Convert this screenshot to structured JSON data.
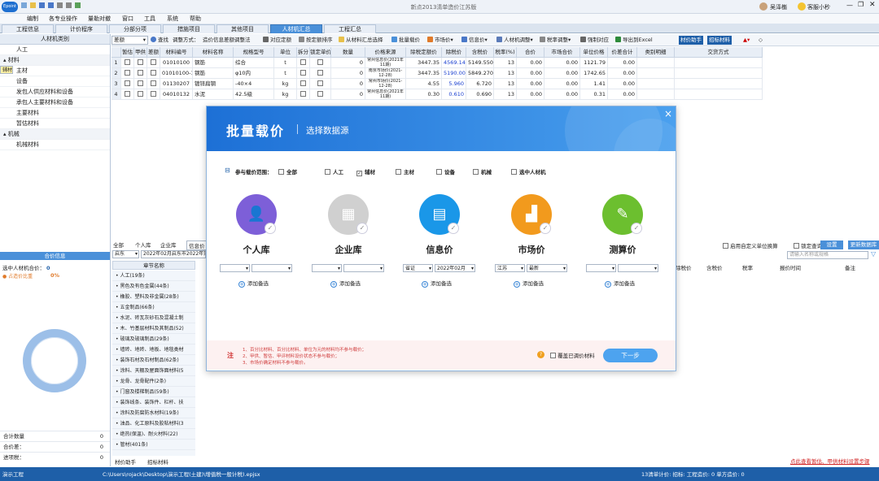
{
  "titlebar": {
    "title": "新点2013清单造价江苏版",
    "user": "吴泽櫆",
    "help": "客服小秒"
  },
  "menu": [
    "编制",
    "各专业操作",
    "量勒对撤",
    "窗口",
    "工具",
    "系统",
    "帮助"
  ],
  "tabs": [
    "工程信息",
    "计价程序",
    "分部分项",
    "措施项目",
    "其他项目",
    "人材机汇总",
    "工程汇总"
  ],
  "toolbar": {
    "filter": "差额",
    "search": "查找",
    "adjust": "调整方式：",
    "adjust_val": "造价信息差额调整法",
    "fixed": "对应定额",
    "sort": "按定额排序",
    "fromsum": "从材料汇总选择",
    "batch": "批量载价",
    "market": "市场价",
    "info": "信息价",
    "rcj": "人材机调整",
    "tax": "税率调整",
    "copy": "强制对应",
    "excel": "导出到Excel",
    "assist": "材价助手",
    "bid": "招标材料"
  },
  "left": {
    "header": "人材机类别",
    "items": [
      {
        "label": "人工",
        "type": "item"
      },
      {
        "label": "材料",
        "type": "grp"
      },
      {
        "label": "辅材",
        "type": "sel"
      },
      {
        "label": "主材",
        "type": "item"
      },
      {
        "label": "设备",
        "type": "item"
      },
      {
        "label": "发包人供应材料和设备",
        "type": "item"
      },
      {
        "label": "承包人主要材料和设备",
        "type": "item"
      },
      {
        "label": "主要材料",
        "type": "item"
      },
      {
        "label": "暂估材料",
        "type": "item"
      },
      {
        "label": "机械",
        "type": "grp"
      },
      {
        "label": "机械材料",
        "type": "item"
      }
    ]
  },
  "grid": {
    "headers": [
      "",
      "暂估",
      "甲供",
      "差额",
      "材料编号",
      "材料名称",
      "规格型号",
      "单位",
      "拆分",
      "锁定单价",
      "数量",
      "价格来源",
      "除税定额价",
      "除税价",
      "含税价",
      "税率(%)",
      "合价",
      "市场合价",
      "单位价格",
      "价差合计",
      "类别明细",
      "交货方式"
    ],
    "rows": [
      [
        "1",
        "",
        "",
        "",
        "01010100",
        "钢筋",
        "综合",
        "t",
        "",
        "",
        "0",
        "常州信息价(2021年11期)",
        "3447.35",
        "4569.140",
        "5149.550",
        "13",
        "0.00",
        "0.00",
        "1121.79",
        "0.00",
        "",
        ""
      ],
      [
        "2",
        "",
        "",
        "",
        "01010100-1",
        "钢筋",
        "φ10内",
        "t",
        "",
        "",
        "0",
        "南京市场价(2021-12-28)",
        "3447.35",
        "5190.000",
        "5849.270",
        "13",
        "0.00",
        "0.00",
        "1742.65",
        "0.00",
        "",
        ""
      ],
      [
        "3",
        "",
        "",
        "",
        "01130207",
        "镀锌扁钢",
        "-40×4",
        "kg",
        "",
        "",
        "0",
        "常州市场价(2021-12-28)",
        "4.55",
        "5.960",
        "6.720",
        "13",
        "0.00",
        "0.00",
        "1.41",
        "0.00",
        "",
        ""
      ],
      [
        "4",
        "",
        "",
        "",
        "04010132",
        "水泥",
        "42.5级",
        "kg",
        "",
        "",
        "0",
        "常州信息价(2021年11期)",
        "0.30",
        "0.610",
        "0.690",
        "13",
        "0.00",
        "0.00",
        "0.31",
        "0.00",
        "",
        ""
      ]
    ]
  },
  "leftbot": {
    "header": "合价信息",
    "sel_label": "选中人材机合价：",
    "sel_val": "0",
    "ratio_label": "占造价比重",
    "ratio_val": "0%",
    "rows": [
      {
        "k": "合计数量",
        "v": "0"
      },
      {
        "k": "合价差：",
        "v": "0"
      },
      {
        "k": "进项税：",
        "v": "0"
      }
    ]
  },
  "bottomtabs": [
    "全部",
    "个人库",
    "企业库",
    "信息价"
  ],
  "bottomfilter": {
    "city": "启东",
    "period": "2022年02月启东市2022年第"
  },
  "chapter": {
    "header": "章节名称",
    "items": [
      "人工(19条)",
      "黑色及有色金属(44条)",
      "橡胶、塑料及非金属(28条)",
      "五金制品(66条)",
      "水泥、砖瓦灰砂石及混凝土制",
      "木、竹基层材料及其制品(52)",
      "玻璃及玻璃制品(29条)",
      "墙砖、地砖、地板、地毯类材",
      "装饰石材及石材制品(62条)",
      "涂料、天棚及屋面饰面材料(5",
      "龙骨、龙骨配件(2条)",
      "门窗及楼梯制品(59条)",
      "装饰线条、装饰件、栏杆、扶",
      "涂料及防腐防水材料(19条)",
      "油品、化工原料及胶粘材料(3",
      "绝热(保温)、耐火材料(22)",
      "管材(401条)"
    ]
  },
  "rightbar": {
    "chk1": "启用自定义单位换算",
    "chk2": "锁定查询",
    "btn1": "设置",
    "btn2": "更新数据库",
    "search_ph": "请输入名称或规格",
    "cols": [
      "除税价",
      "含税价",
      "税率",
      "报价时间",
      "备注"
    ]
  },
  "bottomleftnav": [
    "材价助手",
    "招标材料"
  ],
  "dialog": {
    "title": "批量载价",
    "subtitle": "选择数据源",
    "close": "×",
    "scope_label": "参与载价范围：",
    "scope": [
      {
        "label": "全部",
        "checked": false
      },
      {
        "label": "人工",
        "checked": false
      },
      {
        "label": "辅材",
        "checked": true
      },
      {
        "label": "主材",
        "checked": false
      },
      {
        "label": "设备",
        "checked": false
      },
      {
        "label": "机械",
        "checked": false
      },
      {
        "label": "选中人材机",
        "checked": false
      }
    ],
    "sources": [
      {
        "name": "个人库",
        "color": "#7d5fd8",
        "icon": "person-icon",
        "s1": "",
        "s2": ""
      },
      {
        "name": "企业库",
        "color": "#d0d0d0",
        "icon": "building-icon",
        "s1": "",
        "s2": ""
      },
      {
        "name": "信息价",
        "color": "#1a97e8",
        "icon": "document-icon",
        "s1": "省证",
        "s2": "2022年02月"
      },
      {
        "name": "市场价",
        "color": "#f29a1d",
        "icon": "chart-icon",
        "s1": "江苏",
        "s2": "最新"
      },
      {
        "name": "测算价",
        "color": "#6cbf2f",
        "icon": "calc-icon",
        "s1": "",
        "s2": ""
      }
    ],
    "add_filter": "添加备选",
    "note_tag": "注",
    "notes": [
      "1、百分比材料、百分比材料、单位为元的材料均不参与载价；",
      "2、甲供、暂估、甲评材料设价状态不参与载价；",
      "3、市场价确定材料不参与载价。"
    ],
    "cover": "覆盖已调价材料",
    "next": "下一步"
  },
  "status": {
    "left": "演示工程",
    "path": "C:\\Users\\rojack\\Desktop\\演示工程(土建)\\增值税一般计税).epjsx",
    "right": "13清单计价: 招标: 工程造价: 0 单方造价: 0"
  },
  "redtext": "点此查看暂估、甲供材料设置步骤"
}
